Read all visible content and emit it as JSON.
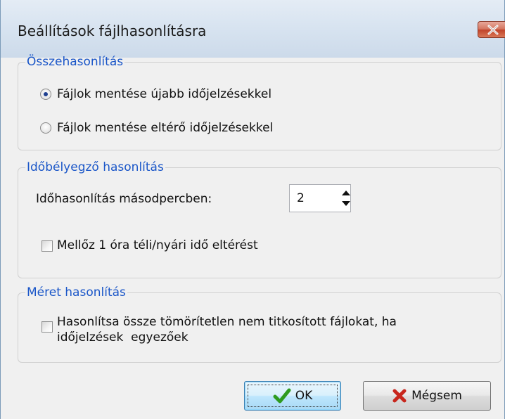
{
  "window": {
    "title": "Beállítások fájlhasonlításra"
  },
  "comparison": {
    "legend": "Összehasonlítás",
    "options": [
      {
        "label": "Fájlok mentése újabb időjelzésekkel",
        "checked": true
      },
      {
        "label": "Fájlok mentése eltérő időjelzésekkel",
        "checked": false
      }
    ]
  },
  "timestamp": {
    "legend": "Időbélyegző hasonlítás",
    "seconds_label": "Időhasonlítás másodpercben:",
    "seconds_value": "2",
    "dst_label": "Mellőz 1 óra téli/nyári idő eltérést",
    "dst_checked": false
  },
  "size": {
    "legend": "Méret hasonlítás",
    "compare_line1": "Hasonlítsa össze tömörítetlen nem titkosított fájlokat, ha",
    "compare_line2": "időjelzések  egyezőek",
    "compare_checked": false
  },
  "buttons": {
    "ok_label": "OK",
    "cancel_label": "Mégsem"
  },
  "icons": {
    "close": "close-icon",
    "ok": "checkmark-icon",
    "cancel": "x-icon"
  },
  "colors": {
    "legend_text": "#1a56c8",
    "ok_check": "#2e9b1f",
    "cancel_x": "#c8261d"
  }
}
